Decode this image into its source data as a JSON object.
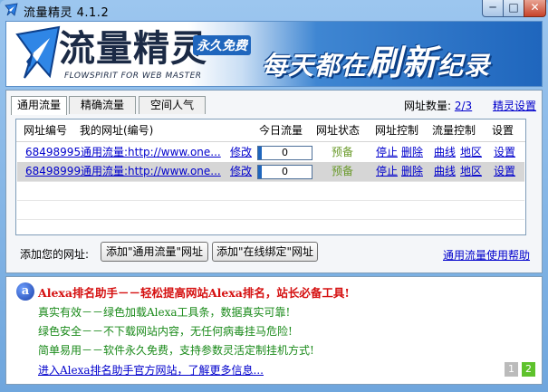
{
  "window": {
    "title": "流量精灵 4.1.2",
    "min_label": "─",
    "max_label": "□",
    "close_label": "✕"
  },
  "banner": {
    "brand": "流量精灵",
    "brand_sub": "FLOWSPIRIT FOR WEB MASTER",
    "badge": "永久免费",
    "slogan_a": "每天都在",
    "slogan_b": "刷新",
    "slogan_c": "纪录"
  },
  "tabs": [
    {
      "label": "通用流量"
    },
    {
      "label": "精确流量"
    },
    {
      "label": "空间人气"
    }
  ],
  "url_count": {
    "label": "网址数量:",
    "value": "2/3"
  },
  "settings_link": "精灵设置",
  "table": {
    "headers": [
      "网址编号",
      "我的网址(编号)",
      "今日流量",
      "网址状态",
      "网址控制",
      "流量控制",
      "设置"
    ],
    "rows": [
      {
        "id": "68498995",
        "url": "通用流量:http://www.one...",
        "edit": "修改",
        "traffic": "0",
        "status": "预备",
        "stop": "停止",
        "del": "删除",
        "curve": "曲线",
        "region": "地区",
        "setting": "设置"
      },
      {
        "id": "68498999",
        "url": "通用流量:http://www.one...",
        "edit": "修改",
        "traffic": "0",
        "status": "预备",
        "stop": "停止",
        "del": "删除",
        "curve": "曲线",
        "region": "地区",
        "setting": "设置"
      }
    ]
  },
  "add": {
    "label": "添加您的网址:",
    "btn1": "添加\"通用流量\"网址",
    "btn2": "添加\"在线绑定\"网址",
    "help": "通用流量使用帮助"
  },
  "info": {
    "icon_letter": "a",
    "title": "Alexa排名助手－－轻松提高网站Alexa排名，站长必备工具!",
    "lines": [
      "真实有效－－绿色加载Alexa工具条，数据真实可靠!",
      "绿色安全－－不下载网站内容，无任何病毒挂马危险!",
      "简单易用－－软件永久免费，支持参数灵活定制挂机方式!"
    ],
    "link": "进入Alexa排名助手官方网站，了解更多信息...",
    "pages": [
      "1",
      "2"
    ]
  },
  "colors": {
    "accent": "#1f66bd",
    "status_green": "#6a9a2a",
    "info_red": "#d51010",
    "info_green": "#1a8a1a",
    "link": "#0000cc"
  }
}
